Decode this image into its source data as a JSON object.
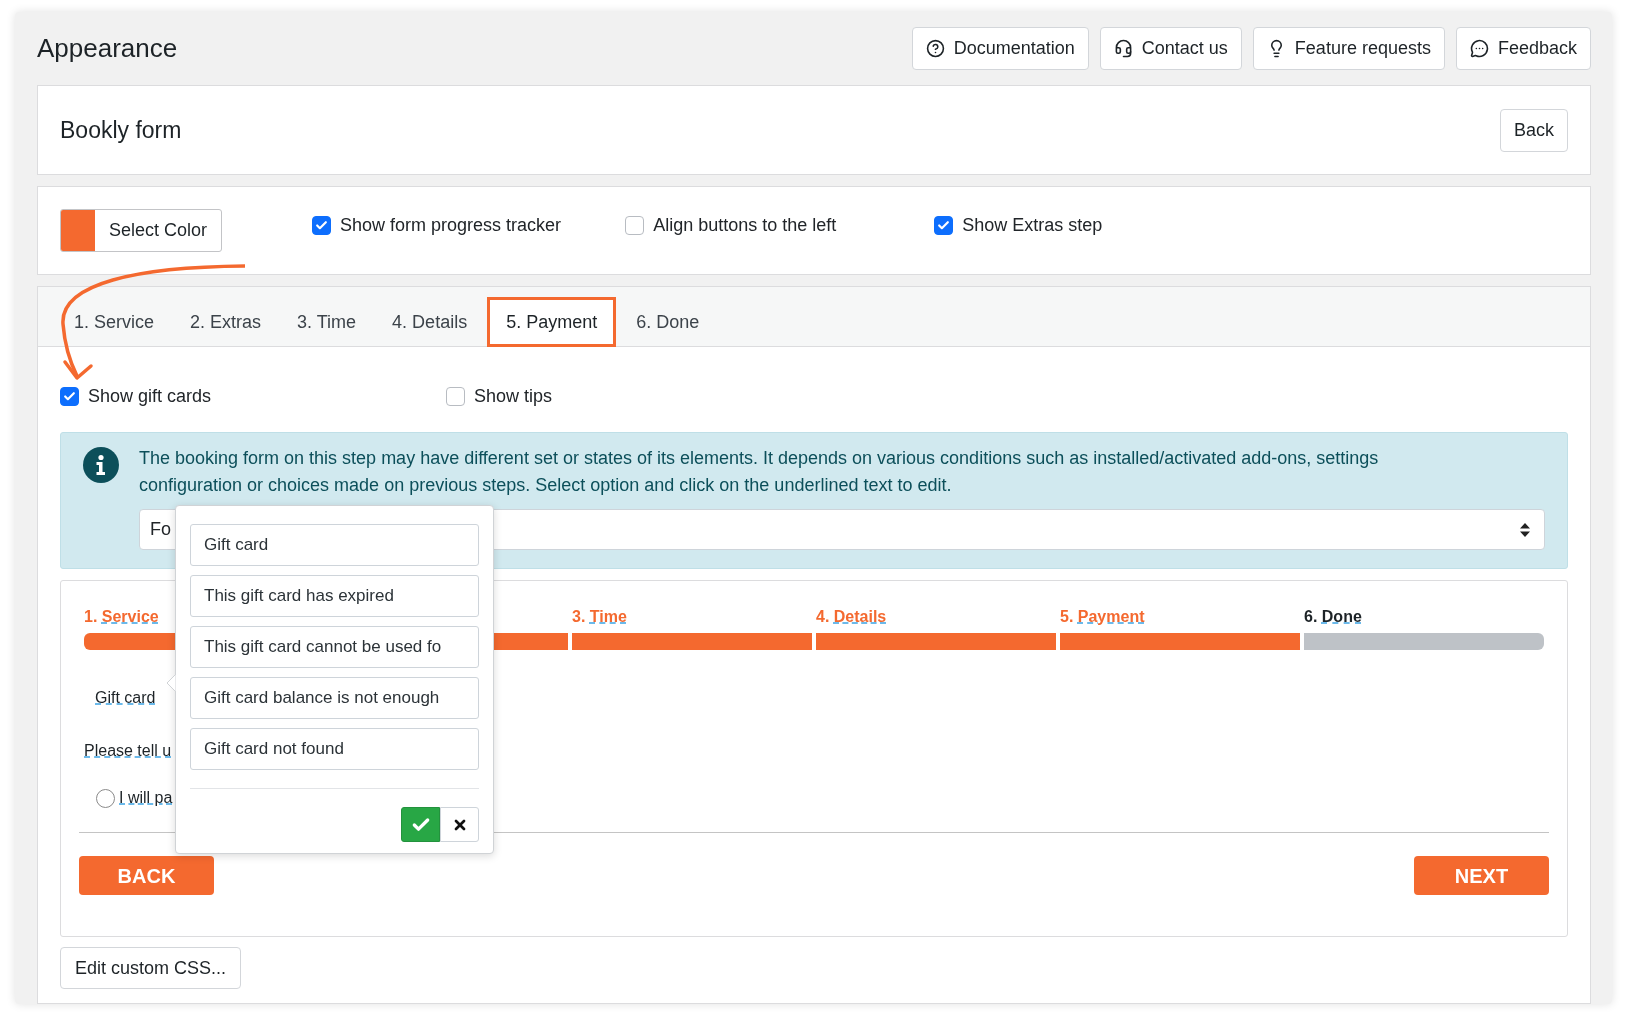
{
  "header": {
    "title": "Appearance",
    "buttons": [
      {
        "label": "Documentation"
      },
      {
        "label": "Contact us"
      },
      {
        "label": "Feature requests"
      },
      {
        "label": "Feedback"
      }
    ]
  },
  "form_card": {
    "title": "Bookly form",
    "back_button": "Back"
  },
  "settings": {
    "color_button": {
      "label": "Select Color",
      "color": "#f4692f"
    },
    "options": [
      {
        "label": "Show form progress tracker",
        "checked": true
      },
      {
        "label": "Align buttons to the left",
        "checked": false
      },
      {
        "label": "Show Extras step",
        "checked": true
      }
    ]
  },
  "tabs": [
    {
      "label": "1. Service",
      "selected": false
    },
    {
      "label": "2. Extras",
      "selected": false
    },
    {
      "label": "3. Time",
      "selected": false
    },
    {
      "label": "4. Details",
      "selected": false
    },
    {
      "label": "5. Payment",
      "selected": true
    },
    {
      "label": "6. Done",
      "selected": false
    }
  ],
  "step_options": [
    {
      "label": "Show gift cards",
      "checked": true
    },
    {
      "label": "Show tips",
      "checked": false
    }
  ],
  "info": {
    "text": "The booking form on this step may have different set or states of its elements. It depends on various conditions such as installed/activated add-ons, settings configuration or choices made on previous steps. Select option and click on the underlined text to edit.",
    "select_value": "Fo"
  },
  "preview": {
    "steps": [
      {
        "number": "1.",
        "label": "Service",
        "done": true
      },
      {
        "done": true
      },
      {
        "number": "3.",
        "label": "Time",
        "done": true
      },
      {
        "number": "4.",
        "label": "Details",
        "done": true
      },
      {
        "number": "5.",
        "label": "Payment",
        "done": true
      },
      {
        "number": "6.",
        "label": "Done",
        "done": false
      }
    ],
    "gift_card_label": "Gift card",
    "question": "Please tell u",
    "radio": {
      "label": "I will pa",
      "selected": false
    },
    "back_button": "BACK",
    "next_button": "NEXT"
  },
  "popover": {
    "fields": [
      "Gift card",
      "This gift card has expired",
      "This gift card cannot be used fo",
      "Gift card balance is not enough",
      "Gift card not found"
    ]
  },
  "edit_css_button": "Edit custom CSS..."
}
